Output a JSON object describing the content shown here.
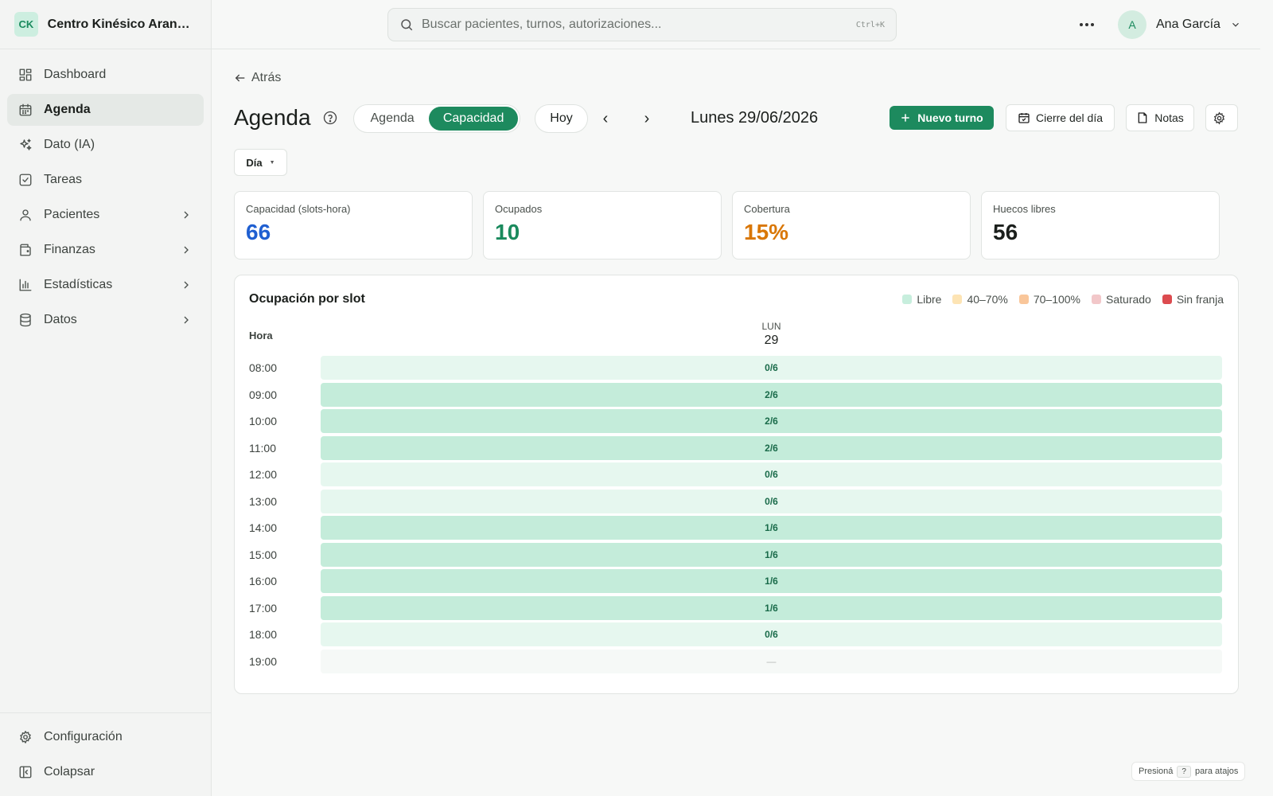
{
  "brand": {
    "initials": "CK",
    "name": "Centro Kinésico Arangu...",
    "accent": "#1d8a5e"
  },
  "sidebar": {
    "items": [
      {
        "label": "Dashboard",
        "icon": "dashboard-icon",
        "active": false,
        "chevron": false
      },
      {
        "label": "Agenda",
        "icon": "calendar-icon",
        "active": true,
        "chevron": false
      },
      {
        "label": "Dato (IA)",
        "icon": "sparkle-icon",
        "active": false,
        "chevron": false
      },
      {
        "label": "Tareas",
        "icon": "checkbox-icon",
        "active": false,
        "chevron": false
      },
      {
        "label": "Pacientes",
        "icon": "user-icon",
        "active": false,
        "chevron": true
      },
      {
        "label": "Finanzas",
        "icon": "wallet-icon",
        "active": false,
        "chevron": true
      },
      {
        "label": "Estadísticas",
        "icon": "bar-chart-icon",
        "active": false,
        "chevron": true
      },
      {
        "label": "Datos",
        "icon": "database-icon",
        "active": false,
        "chevron": true
      }
    ],
    "bottom": [
      {
        "label": "Configuración",
        "icon": "gear-icon"
      },
      {
        "label": "Colapsar",
        "icon": "collapse-icon"
      }
    ]
  },
  "topbar": {
    "search_placeholder": "Buscar pacientes, turnos, autorizaciones...",
    "shortcut": "Ctrl+K",
    "user_initial": "A",
    "user_name": "Ana García"
  },
  "main": {
    "back_label": "Atrás",
    "title": "Agenda",
    "view_tabs": {
      "agenda": "Agenda",
      "capacidad": "Capacidad"
    },
    "today_label": "Hoy",
    "prev": "‹",
    "next": "›",
    "date_label": "Lunes 29/06/2026",
    "new_label": "Nuevo turno",
    "close_label": "Cierre del día",
    "notes_label": "Notas",
    "range_label": "Día",
    "range_caret": "▼"
  },
  "stats": [
    {
      "label": "Capacidad (slots-hora)",
      "value": "66",
      "color": "#1f5fd1"
    },
    {
      "label": "Ocupados",
      "value": "10",
      "color": "#1a8a5d"
    },
    {
      "label": "Cobertura",
      "value": "15%",
      "color": "#d97706"
    },
    {
      "label": "Huecos libres",
      "value": "56",
      "color": "#1b1f1c"
    }
  ],
  "occupancy": {
    "title": "Ocupación por slot",
    "legend": [
      {
        "label": "Libre",
        "color": "#c7eedd"
      },
      {
        "label": "40–70%",
        "color": "#fde4b4"
      },
      {
        "label": "70–100%",
        "color": "#f9c69a"
      },
      {
        "label": "Saturado",
        "color": "#f2c7c9"
      },
      {
        "label": "Sin franja",
        "color": "#dc4b4f"
      }
    ],
    "hora_label": "Hora",
    "day_dow": "LUN",
    "day_num": "29",
    "rows": [
      {
        "time": "08:00",
        "label": "0/6",
        "used": 0,
        "total": 6
      },
      {
        "time": "09:00",
        "label": "2/6",
        "used": 2,
        "total": 6
      },
      {
        "time": "10:00",
        "label": "2/6",
        "used": 2,
        "total": 6
      },
      {
        "time": "11:00",
        "label": "2/6",
        "used": 2,
        "total": 6
      },
      {
        "time": "12:00",
        "label": "0/6",
        "used": 0,
        "total": 6
      },
      {
        "time": "13:00",
        "label": "0/6",
        "used": 0,
        "total": 6
      },
      {
        "time": "14:00",
        "label": "1/6",
        "used": 1,
        "total": 6
      },
      {
        "time": "15:00",
        "label": "1/6",
        "used": 1,
        "total": 6
      },
      {
        "time": "16:00",
        "label": "1/6",
        "used": 1,
        "total": 6
      },
      {
        "time": "17:00",
        "label": "1/6",
        "used": 1,
        "total": 6
      },
      {
        "time": "18:00",
        "label": "0/6",
        "used": 0,
        "total": 6
      },
      {
        "time": "19:00",
        "label": "—",
        "used": null,
        "total": null
      }
    ]
  },
  "hint": {
    "pre": "Presioná",
    "key": "?",
    "post": "para atajos"
  }
}
